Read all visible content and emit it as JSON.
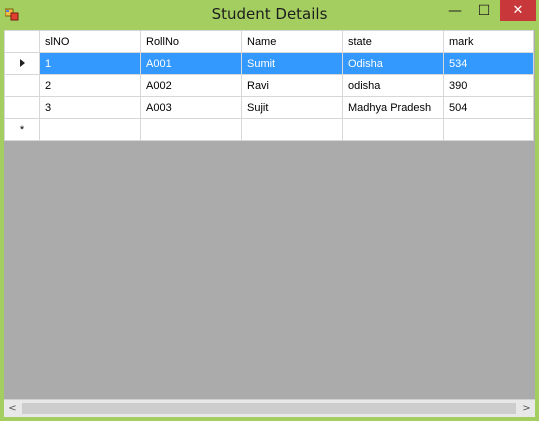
{
  "window": {
    "title": "Student Details",
    "controls": {
      "minimize": "—",
      "maximize": "☐",
      "close": "✕"
    },
    "colors": {
      "frame": "#a4cf60",
      "close": "#c8373a",
      "selection": "#3399ff",
      "grid_background": "#ababab"
    }
  },
  "grid": {
    "columns": [
      "slNO",
      "RollNo",
      "Name",
      "state",
      "mark"
    ],
    "rows": [
      {
        "cells": [
          "1",
          "A001",
          "Sumit",
          "Odisha",
          "534"
        ],
        "selected": true,
        "current": true
      },
      {
        "cells": [
          "2",
          "A002",
          "Ravi",
          "odisha",
          "390"
        ],
        "selected": false,
        "current": false
      },
      {
        "cells": [
          "3",
          "A003",
          "Sujit",
          "Madhya Pradesh",
          "504"
        ],
        "selected": false,
        "current": false
      }
    ],
    "new_row_marker": "*"
  },
  "scrollbar": {
    "left": "<",
    "right": ">"
  },
  "icons": [
    "app-icon",
    "current-row-arrow-icon",
    "new-row-star-icon"
  ]
}
